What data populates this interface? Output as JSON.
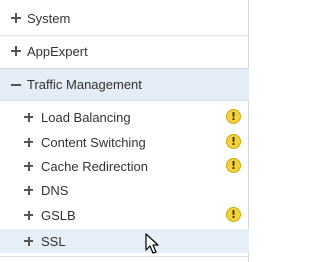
{
  "tree": {
    "top_items": [
      {
        "label": "System",
        "state": "collapsed"
      },
      {
        "label": "AppExpert",
        "state": "collapsed"
      },
      {
        "label": "Traffic Management",
        "state": "expanded"
      }
    ],
    "children": [
      {
        "label": "Load Balancing",
        "warning": true
      },
      {
        "label": "Content Switching",
        "warning": true
      },
      {
        "label": "Cache Redirection",
        "warning": true
      },
      {
        "label": "DNS",
        "warning": false
      },
      {
        "label": "GSLB",
        "warning": true
      },
      {
        "label": "SSL",
        "warning": false,
        "hovered": true
      }
    ],
    "warning_glyph": "!",
    "colors": {
      "warning": "#f4d23a",
      "expanded_bg": "#e4ecf5",
      "hover_bg": "#e6eef7"
    }
  }
}
